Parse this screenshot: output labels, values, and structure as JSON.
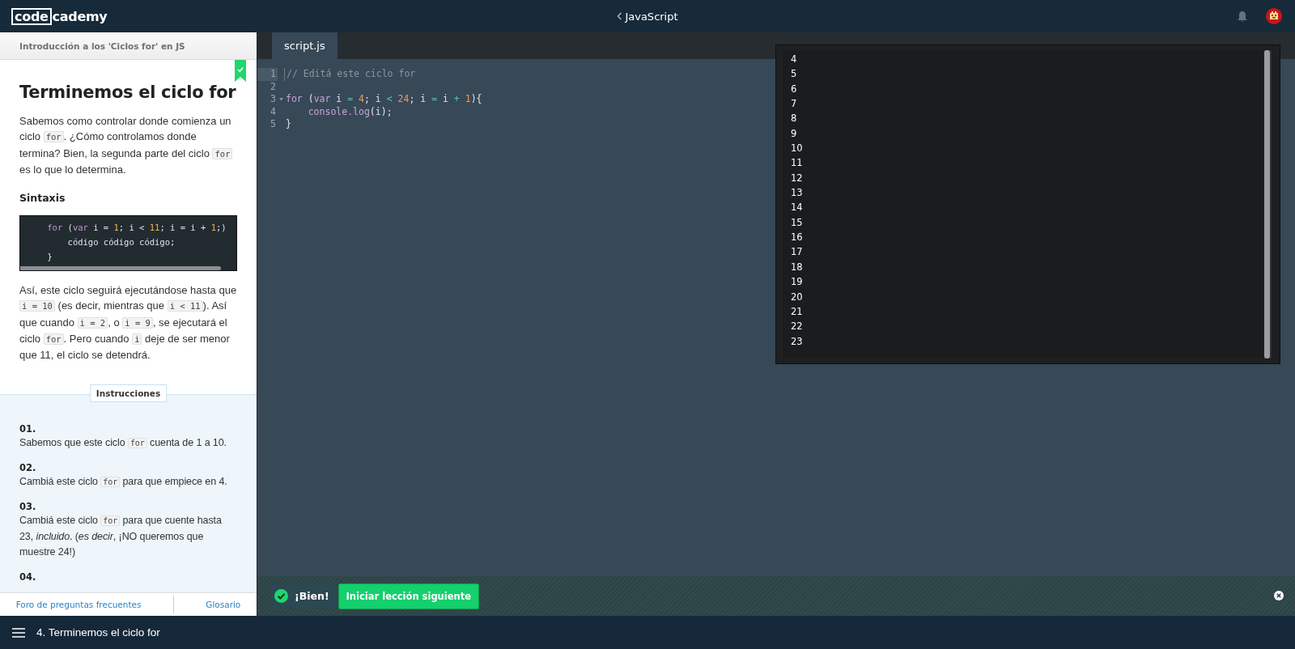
{
  "topbar": {
    "logo_box": "code",
    "logo_rest": "cademy",
    "course": "JavaScript"
  },
  "lesson": {
    "breadcrumb": "Introducción a los 'Ciclos for' en JS",
    "completed": true,
    "title": "Terminemos el ciclo for",
    "paragraphs": [
      [
        {
          "kind": "text",
          "text": "Sabemos como controlar donde comienza un ciclo "
        },
        {
          "kind": "code",
          "text": "for"
        },
        {
          "kind": "text",
          "text": ". ¿Cómo controlamos donde termina? Bien, la segunda parte del ciclo "
        },
        {
          "kind": "code",
          "text": "for"
        },
        {
          "kind": "text",
          "text": " es lo que lo determina."
        }
      ]
    ],
    "subheading": "Sintaxis",
    "example": [
      [
        {
          "kind": "keyword",
          "text": "    for "
        },
        {
          "kind": "plain",
          "text": "("
        },
        {
          "kind": "keyword",
          "text": "var "
        },
        {
          "kind": "plain",
          "text": "i = "
        },
        {
          "kind": "number",
          "text": "1"
        },
        {
          "kind": "plain",
          "text": "; i < "
        },
        {
          "kind": "number",
          "text": "11"
        },
        {
          "kind": "plain",
          "text": "; i = i + "
        },
        {
          "kind": "number",
          "text": "1"
        },
        {
          "kind": "plain",
          "text": ";)"
        }
      ],
      [
        {
          "kind": "plain",
          "text": "        código código código;"
        }
      ],
      [
        {
          "kind": "plain",
          "text": "    }"
        }
      ]
    ],
    "paragraphs_after": [
      [
        {
          "kind": "text",
          "text": "Así, este ciclo seguirá ejecutándose hasta que "
        },
        {
          "kind": "code",
          "text": "i = 10"
        },
        {
          "kind": "text",
          "text": " (es decir, mientras que "
        },
        {
          "kind": "code",
          "text": "i < 11"
        },
        {
          "kind": "text",
          "text": "). Así que cuando "
        },
        {
          "kind": "code",
          "text": "i = 2"
        },
        {
          "kind": "text",
          "text": ", o "
        },
        {
          "kind": "code",
          "text": "i = 9"
        },
        {
          "kind": "text",
          "text": ", se ejecutará el ciclo "
        },
        {
          "kind": "code",
          "text": "for"
        },
        {
          "kind": "text",
          "text": ". Pero cuando "
        },
        {
          "kind": "code",
          "text": "i"
        },
        {
          "kind": "text",
          "text": " deje de ser menor que 11, el ciclo se detendrá."
        }
      ]
    ],
    "instructions_label": "Instrucciones",
    "steps": [
      {
        "number": "01.",
        "body": [
          {
            "kind": "text",
            "text": "Sabemos que este ciclo "
          },
          {
            "kind": "code",
            "text": "for"
          },
          {
            "kind": "text",
            "text": " cuenta de 1 a 10."
          }
        ]
      },
      {
        "number": "02.",
        "body": [
          {
            "kind": "text",
            "text": "Cambiá este ciclo "
          },
          {
            "kind": "code",
            "text": "for"
          },
          {
            "kind": "text",
            "text": " para que empiece en 4."
          }
        ]
      },
      {
        "number": "03.",
        "body": [
          {
            "kind": "text",
            "text": "Cambiá este ciclo "
          },
          {
            "kind": "code",
            "text": "for"
          },
          {
            "kind": "text",
            "text": " para que cuente hasta 23, "
          },
          {
            "kind": "italic",
            "text": "incluido"
          },
          {
            "kind": "text",
            "text": ". ("
          },
          {
            "kind": "italic",
            "text": "es decir"
          },
          {
            "kind": "text",
            "text": ", ¡NO queremos que muestre 24!)"
          }
        ]
      },
      {
        "number": "04."
      }
    ],
    "footer_links": [
      "Foro de preguntas frecuentes",
      "Glosario"
    ]
  },
  "editor": {
    "tabs": [
      {
        "label": "script.js",
        "selected": true
      }
    ],
    "lines": [
      {
        "number": "1",
        "active": true,
        "tokens": [
          {
            "kind": "comment",
            "text": "// Editá este ciclo for"
          }
        ]
      },
      {
        "number": "2",
        "active": false
      },
      {
        "number": "3",
        "active": false,
        "foldable": true,
        "tokens": [
          {
            "kind": "keyword",
            "text": "for"
          },
          {
            "kind": "plain",
            "text": " ("
          },
          {
            "kind": "keyword",
            "text": "var"
          },
          {
            "kind": "plain",
            "text": " i "
          },
          {
            "kind": "operator",
            "text": "="
          },
          {
            "kind": "number",
            "text": " 4"
          },
          {
            "kind": "plain",
            "text": "; i "
          },
          {
            "kind": "operator",
            "text": "<"
          },
          {
            "kind": "number",
            "text": " 24"
          },
          {
            "kind": "plain",
            "text": "; i "
          },
          {
            "kind": "operator",
            "text": "="
          },
          {
            "kind": "plain",
            "text": " i "
          },
          {
            "kind": "operator",
            "text": "+"
          },
          {
            "kind": "number",
            "text": " 1"
          },
          {
            "kind": "plain",
            "text": "){"
          }
        ]
      },
      {
        "number": "4",
        "active": false,
        "tokens": [
          {
            "kind": "fn",
            "text": "    console.log"
          },
          {
            "kind": "plain",
            "text": "(i);"
          }
        ]
      },
      {
        "number": "5",
        "active": false,
        "tokens": [
          {
            "kind": "plain",
            "text": "}"
          }
        ]
      }
    ]
  },
  "output": {
    "lines": [
      "4",
      "5",
      "6",
      "7",
      "8",
      "9",
      "10",
      "11",
      "12",
      "13",
      "14",
      "15",
      "16",
      "17",
      "18",
      "19",
      "20",
      "21",
      "22",
      "23"
    ]
  },
  "notification": {
    "message": "¡Bien!",
    "button": "Iniciar lección siguiente"
  },
  "bottom_bar": {
    "lesson": "4. Terminemos el ciclo for"
  }
}
